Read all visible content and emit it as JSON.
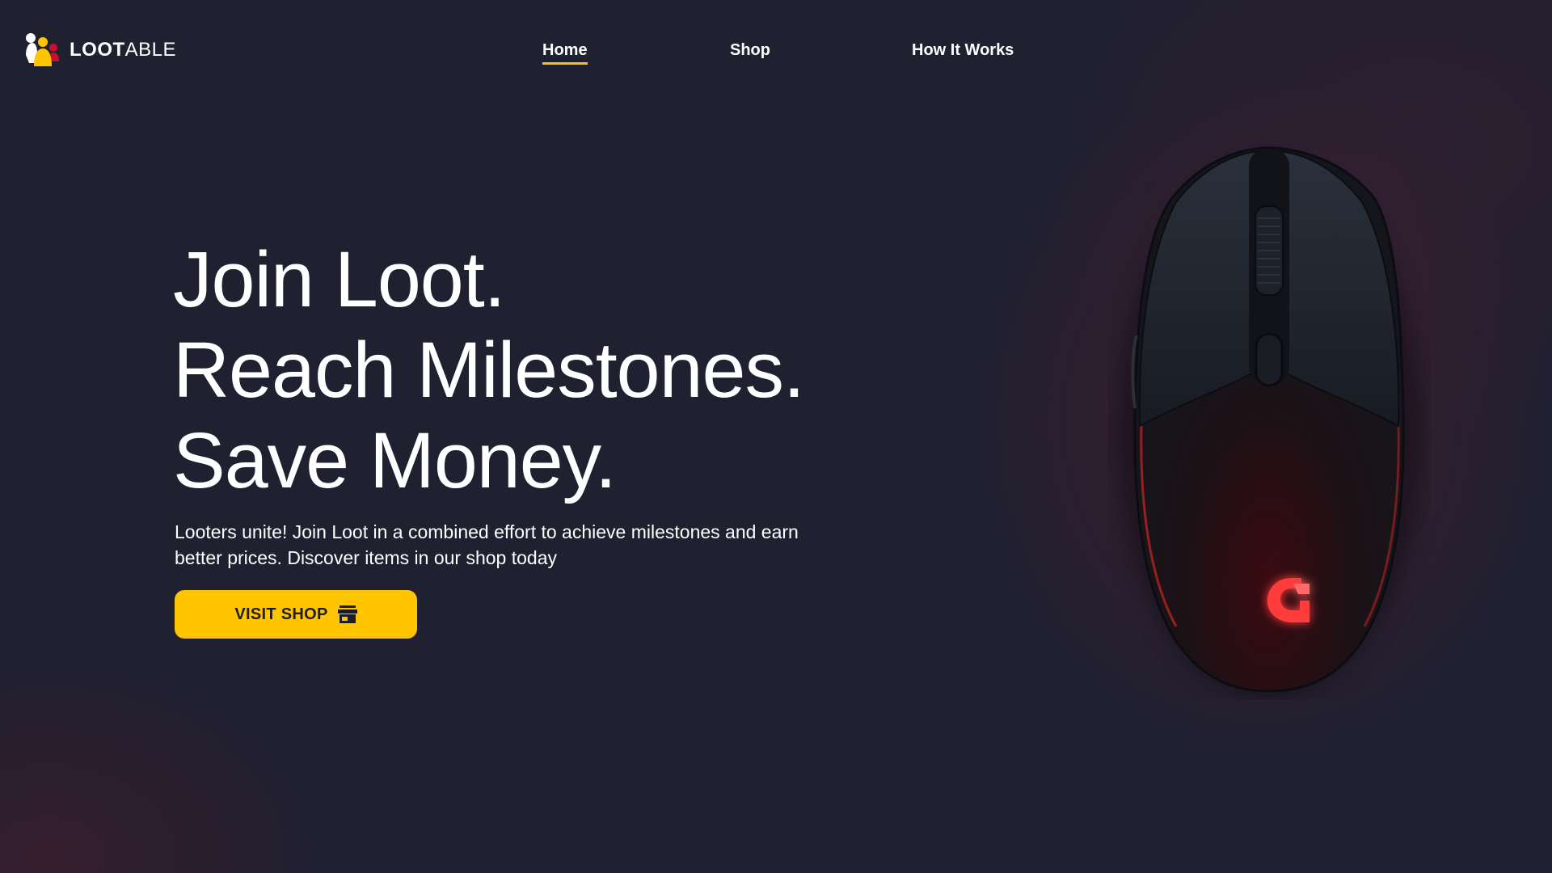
{
  "brand": {
    "name_bold": "LOOT",
    "name_light": "ABLE",
    "logo_icon": "people-group-icon",
    "colors": {
      "yellow": "#ffc500",
      "red": "#c8102e",
      "dark": "#1f2030"
    }
  },
  "nav": {
    "items": [
      {
        "label": "Home",
        "active": true
      },
      {
        "label": "Shop",
        "active": false
      },
      {
        "label": "How It Works",
        "active": false
      }
    ]
  },
  "hero": {
    "title_lines": [
      "Join Loot.",
      "Reach Milestones.",
      "Save Money."
    ],
    "description": "Looters unite! Join Loot in a combined effort to achieve milestones and earn better prices. Discover items in our shop today",
    "cta": {
      "label": "VISIT SHOP",
      "icon": "storefront-icon"
    }
  },
  "product_image": {
    "subject": "gaming mouse",
    "accent_color": "#ff2a2a"
  }
}
